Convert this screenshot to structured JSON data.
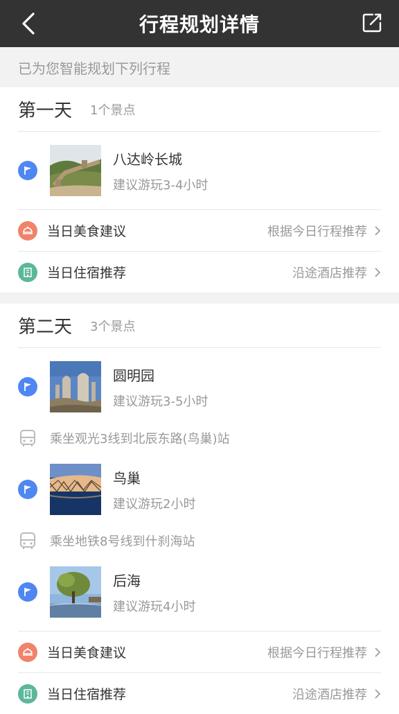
{
  "header": {
    "title": "行程规划详情"
  },
  "subtitle": "已为您智能规划下列行程",
  "days": [
    {
      "title": "第一天",
      "count": "1个景点",
      "spot1": {
        "name": "八达岭长城",
        "duration": "建议游玩3-4小时"
      },
      "food": {
        "label": "当日美食建议",
        "hint": "根据今日行程推荐"
      },
      "hotel": {
        "label": "当日住宿推荐",
        "hint": "沿途酒店推荐"
      }
    },
    {
      "title": "第二天",
      "count": "3个景点",
      "spot1": {
        "name": "圆明园",
        "duration": "建议游玩3-5小时"
      },
      "transit1": "乘坐观光3线到北辰东路(鸟巢)站",
      "spot2": {
        "name": "鸟巢",
        "duration": "建议游玩2小时"
      },
      "transit2": "乘坐地铁8号线到什刹海站",
      "spot3": {
        "name": "后海",
        "duration": "建议游玩4小时"
      },
      "food": {
        "label": "当日美食建议",
        "hint": "根据今日行程推荐"
      },
      "hotel": {
        "label": "当日住宿推荐",
        "hint": "沿途酒店推荐"
      }
    }
  ],
  "colors": {
    "topbar": "#333333",
    "flag": "#4f87f2",
    "food": "#f0836a",
    "hotel": "#5cb79b",
    "muted": "#999999"
  },
  "icons": [
    "back-arrow-icon",
    "share-icon",
    "flag-icon",
    "food-icon",
    "hotel-icon",
    "bus-icon",
    "chevron-right-icon"
  ]
}
